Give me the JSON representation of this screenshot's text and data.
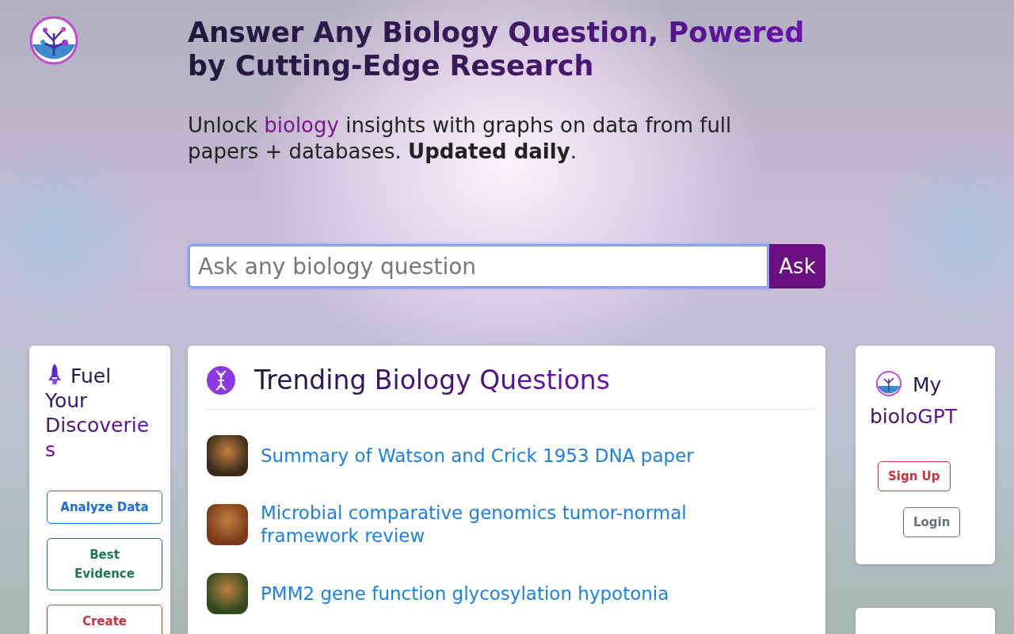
{
  "hero": {
    "title": "Answer Any Biology Question, Powered by Cutting-Edge Research",
    "subtitle": {
      "before": "Unlock ",
      "highlight": "biology",
      "after": " insights with graphs on data from full papers + databases. **Updated daily**."
    }
  },
  "search": {
    "placeholder": "Ask any biology question",
    "button": "Ask"
  },
  "left_card": {
    "title": "Fuel Your Discoveries",
    "buttons": [
      {
        "label": "Analyze Data",
        "kind": "primary"
      },
      {
        "label": "Best Evidence",
        "kind": "success"
      },
      {
        "label": "Create",
        "kind": "danger"
      }
    ]
  },
  "trending": {
    "title": "Trending Biology Questions",
    "items": [
      {
        "label": "Summary of Watson and Crick 1953 DNA paper"
      },
      {
        "label": "Microbial comparative genomics tumor-normal framework review"
      },
      {
        "label": "PMM2 gene function glycosylation hypotonia"
      }
    ]
  },
  "right_card": {
    "title": "My bioloGPT",
    "buttons": [
      {
        "label": "Sign Up",
        "kind": "danger"
      },
      {
        "label": "Login",
        "kind": "secondary"
      }
    ]
  }
}
